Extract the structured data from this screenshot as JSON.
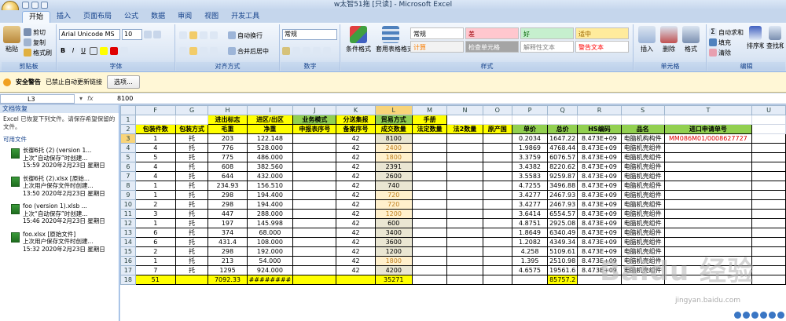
{
  "window": {
    "title": "w太智51拖 [只读] - Microsoft Excel"
  },
  "tabs": [
    "开始",
    "插入",
    "页面布局",
    "公式",
    "数据",
    "审阅",
    "视图",
    "开发工具"
  ],
  "ribbon": {
    "clipboard": {
      "paste": "粘贴",
      "cut": "剪切",
      "copy": "复制",
      "format_painter": "格式刷",
      "label": "剪贴板"
    },
    "font": {
      "name": "Arial Unicode MS",
      "size": "10",
      "label": "字体"
    },
    "alignment": {
      "wrap": "自动换行",
      "merge": "合并后居中",
      "label": "对齐方式"
    },
    "number": {
      "format": "常规",
      "label": "数字"
    },
    "styles": {
      "cond_format": "条件格式",
      "table_format": "套用表格格式",
      "cells_label": "单元格样式",
      "items": [
        {
          "text": "常规",
          "bg": "#ffffff",
          "color": "#000000"
        },
        {
          "text": "差",
          "bg": "#ffc7ce",
          "color": "#9c0006"
        },
        {
          "text": "好",
          "bg": "#c6efce",
          "color": "#006100"
        },
        {
          "text": "适中",
          "bg": "#ffeb9c",
          "color": "#9c6500"
        },
        {
          "text": "计算",
          "bg": "#f2f2f2",
          "color": "#fa7d00"
        },
        {
          "text": "检查单元格",
          "bg": "#a5a5a5",
          "color": "#ffffff"
        },
        {
          "text": "解释性文本",
          "bg": "#ffffff",
          "color": "#7f7f7f"
        },
        {
          "text": "警告文本",
          "bg": "#ffffff",
          "color": "#ff0000"
        }
      ],
      "label": "样式"
    },
    "cells": {
      "insert": "插入",
      "delete": "删除",
      "format": "格式",
      "label": "单元格"
    },
    "editing": {
      "autosum": "自动求和",
      "fill": "填充",
      "clear": "清除",
      "sort": "排序和筛选",
      "find": "查找和选择",
      "label": "编辑"
    }
  },
  "security": {
    "title": "安全警告",
    "message": "已禁止自动更新链接",
    "options": "选项..."
  },
  "formula_bar": {
    "name_box": "L3",
    "value": "8100"
  },
  "recovery": {
    "header": "文档恢复",
    "message": "Excel 已恢复下列文件。请保存希望保留的文件。",
    "available": "可用文件",
    "files": [
      {
        "name": "长御6托 (2) (version 1...",
        "desc": "上次“自动保存”时创建...",
        "time": "15:59 2020年2月23日 星期日"
      },
      {
        "name": "长御6托 (2).xlsx [原始...",
        "desc": "上次用户保存文件时创建...",
        "time": "13:50 2020年2月23日 星期日"
      },
      {
        "name": "foo (version 1).xlsb ...",
        "desc": "上次“自动保存”时创建...",
        "time": "15:46 2020年2月23日 星期日"
      },
      {
        "name": "foo.xlsx [原始文件]",
        "desc": "上次用户保存文件时创建...",
        "time": "15:32 2020年2月23日 星期日"
      }
    ]
  },
  "sheet": {
    "columns": [
      "F",
      "G",
      "H",
      "I",
      "J",
      "K",
      "L",
      "M",
      "N",
      "O",
      "P",
      "Q",
      "R",
      "S",
      "T",
      "U"
    ],
    "row1": [
      "",
      "",
      "进出标志",
      "进区/出区",
      "业务模式",
      "分送集报",
      "贸易方式",
      "手册",
      "",
      "",
      "",
      "",
      "",
      "",
      "",
      ""
    ],
    "row2": [
      "包装件数",
      "包装方式",
      "毛重",
      "净重",
      "申报表序号",
      "备案序号",
      "成交数量",
      "法定数量",
      "法2数量",
      "原产国",
      "单价",
      "总价",
      "HS编码",
      "品名",
      "进口申请单号",
      ""
    ],
    "rows": [
      [
        "1",
        "托",
        "203",
        "122.148",
        "",
        "42",
        "8100",
        "",
        "",
        "",
        "0.2034",
        "1647.22",
        "8.473E+09",
        "电脑机构构件",
        "MM086M01/0008627727",
        ""
      ],
      [
        "4",
        "托",
        "776",
        "528.000",
        "",
        "42",
        "2400",
        "",
        "",
        "",
        "1.9869",
        "4768.44",
        "8.473E+09",
        "电脑机壳组件",
        "",
        ""
      ],
      [
        "5",
        "托",
        "775",
        "486.000",
        "",
        "42",
        "1800",
        "",
        "",
        "",
        "3.3759",
        "6076.57",
        "8.473E+09",
        "电脑机壳组件",
        "",
        ""
      ],
      [
        "4",
        "托",
        "608",
        "382.560",
        "",
        "42",
        "2391",
        "",
        "",
        "",
        "3.4382",
        "8220.62",
        "8.473E+09",
        "电脑机壳组件",
        "",
        ""
      ],
      [
        "4",
        "托",
        "644",
        "432.000",
        "",
        "42",
        "2600",
        "",
        "",
        "",
        "3.5583",
        "9259.87",
        "8.473E+09",
        "电脑机壳组件",
        "",
        ""
      ],
      [
        "1",
        "托",
        "234.93",
        "156.510",
        "",
        "42",
        "740",
        "",
        "",
        "",
        "4.7255",
        "3496.88",
        "8.473E+09",
        "电脑机壳组件",
        "",
        ""
      ],
      [
        "1",
        "托",
        "298",
        "194.400",
        "",
        "42",
        "720",
        "",
        "",
        "",
        "3.4277",
        "2467.93",
        "8.473E+09",
        "电脑机壳组件",
        "",
        ""
      ],
      [
        "2",
        "托",
        "298",
        "194.400",
        "",
        "42",
        "720",
        "",
        "",
        "",
        "3.4277",
        "2467.93",
        "8.473E+09",
        "电脑机壳组件",
        "",
        ""
      ],
      [
        "3",
        "托",
        "447",
        "288.000",
        "",
        "42",
        "1200",
        "",
        "",
        "",
        "3.6414",
        "6554.57",
        "8.473E+09",
        "电脑机壳组件",
        "",
        ""
      ],
      [
        "1",
        "托",
        "197",
        "145.998",
        "",
        "42",
        "600",
        "",
        "",
        "",
        "4.8751",
        "2925.08",
        "8.473E+09",
        "电脑机壳组件",
        "",
        ""
      ],
      [
        "6",
        "托",
        "374",
        "68.000",
        "",
        "42",
        "3400",
        "",
        "",
        "",
        "1.8649",
        "6340.49",
        "8.473E+09",
        "电脑机壳组件",
        "",
        ""
      ],
      [
        "6",
        "托",
        "431.4",
        "108.000",
        "",
        "42",
        "3600",
        "",
        "",
        "",
        "1.2082",
        "4349.34",
        "8.473E+09",
        "电脑机壳组件",
        "",
        ""
      ],
      [
        "2",
        "托",
        "298",
        "192.000",
        "",
        "42",
        "1200",
        "",
        "",
        "",
        "4.258",
        "5109.61",
        "8.473E+09",
        "电脑机壳组件",
        "",
        ""
      ],
      [
        "1",
        "托",
        "213",
        "54.000",
        "",
        "42",
        "1800",
        "",
        "",
        "",
        "1.395",
        "2510.98",
        "8.473E+09",
        "电脑机壳组件",
        "",
        ""
      ],
      [
        "7",
        "托",
        "1295",
        "924.000",
        "",
        "42",
        "4200",
        "",
        "",
        "",
        "4.6575",
        "19561.6",
        "8.473E+09",
        "电脑机壳组件",
        "",
        ""
      ]
    ],
    "totals": [
      "51",
      "",
      "7092.33",
      "########",
      "",
      "",
      "35271",
      "",
      "",
      "",
      "",
      "85757.2",
      "",
      "",
      "",
      ""
    ]
  },
  "watermark": {
    "text": "Baidu 经验",
    "url": "jingyan.baidu.com"
  }
}
